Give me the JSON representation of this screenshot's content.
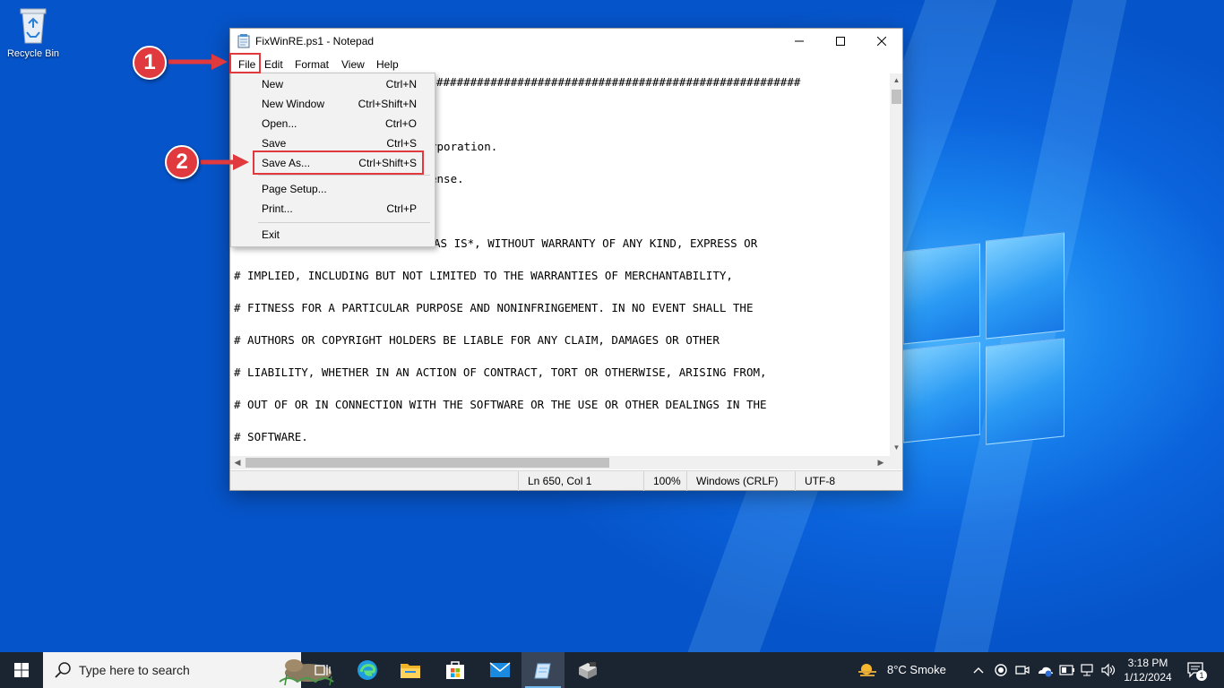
{
  "desktop": {
    "recycle_bin_label": "Recycle Bin"
  },
  "notepad": {
    "title": "FixWinRE.ps1 - Notepad",
    "menu": [
      "File",
      "Edit",
      "Format",
      "View",
      "Help"
    ],
    "lines": [
      "######################################################",
      "rporation.",
      "ense.",
      "AS IS*, WITHOUT WARRANTY OF ANY KIND, EXPRESS OR",
      "# IMPLIED, INCLUDING BUT NOT LIMITED TO THE WARRANTIES OF MERCHANTABILITY,",
      "# FITNESS FOR A PARTICULAR PURPOSE AND NONINFRINGEMENT. IN NO EVENT SHALL THE",
      "# AUTHORS OR COPYRIGHT HOLDERS BE LIABLE FOR ANY CLAIM, DAMAGES OR OTHER",
      "# LIABILITY, WHETHER IN AN ACTION OF CONTRACT, TORT OR OTHERWISE, ARISING FROM,",
      "# OUT OF OR IN CONNECTION WITH THE SOFTWARE OR THE USE OR OTHER DEALINGS IN THE",
      "# SOFTWARE."
    ],
    "status": {
      "position": "Ln 650, Col 1",
      "zoom": "100%",
      "line_ending": "Windows (CRLF)",
      "encoding": "UTF-8"
    }
  },
  "file_menu": {
    "items": [
      {
        "label": "New",
        "shortcut": "Ctrl+N"
      },
      {
        "label": "New Window",
        "shortcut": "Ctrl+Shift+N"
      },
      {
        "label": "Open...",
        "shortcut": "Ctrl+O"
      },
      {
        "label": "Save",
        "shortcut": "Ctrl+S"
      },
      {
        "label": "Save As...",
        "shortcut": "Ctrl+Shift+S"
      },
      {
        "label": "Page Setup...",
        "shortcut": ""
      },
      {
        "label": "Print...",
        "shortcut": "Ctrl+P"
      },
      {
        "label": "Exit",
        "shortcut": ""
      }
    ]
  },
  "annotations": {
    "step1": "1",
    "step2": "2",
    "color": "#e0393e"
  },
  "taskbar": {
    "search_placeholder": "Type here to search",
    "weather": "8°C  Smoke",
    "time": "3:18 PM",
    "date": "1/12/2024",
    "notification_count": "1",
    "pinned_icons": [
      "task-view-icon",
      "edge-icon",
      "file-explorer-icon",
      "store-icon",
      "mail-icon",
      "notepad-icon",
      "app-installer-icon"
    ]
  }
}
